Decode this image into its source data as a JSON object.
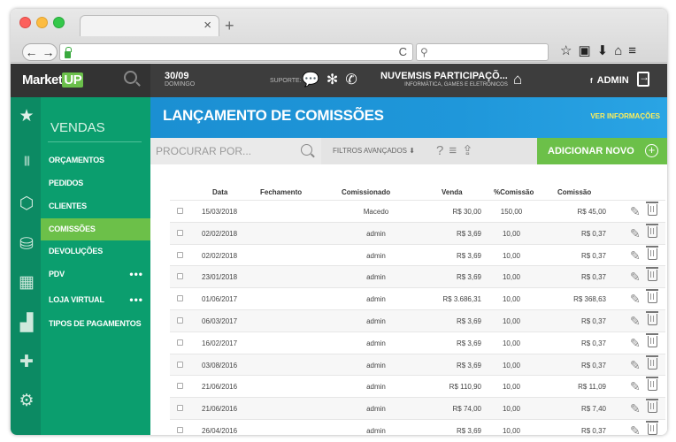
{
  "browser": {
    "tab_close": "×",
    "new_tab": "+",
    "back": "←",
    "forward": "→",
    "reload": "C",
    "search_glass": "⚲",
    "toolbar_icons": "☆▣⬇⌂≡"
  },
  "header": {
    "logo_market": "Market",
    "logo_up": "UP",
    "date": "30/09",
    "weekday": "DOMINGO",
    "support_label": "SUPORTE:",
    "support_icons": "💬✻✆",
    "company": "NUVEMSIS PARTICIPAÇÕ...",
    "company_sub": "INFORMÁTICA, GAMES E ELETRÔNICOS",
    "home_icon": "⌂",
    "user_prefix": "f",
    "user": "ADMIN"
  },
  "iconbar": [
    "★",
    "|||",
    "⬡",
    "⛁",
    "▦",
    "▟",
    "✚",
    "⚙"
  ],
  "sidebar": {
    "title": "VENDAS",
    "items": [
      {
        "label": "ORÇAMENTOS"
      },
      {
        "label": "PEDIDOS"
      },
      {
        "label": "CLIENTES"
      },
      {
        "label": "COMISSÕES",
        "active": true
      },
      {
        "label": "DEVOLUÇÕES"
      },
      {
        "label": "PDV",
        "more": "•••"
      },
      {
        "label": "LOJA VIRTUAL",
        "more": "•••"
      },
      {
        "label": "TIPOS DE PAGAMENTOS"
      }
    ]
  },
  "main": {
    "title": "LANÇAMENTO DE COMISSÕES",
    "more_info": "VER INFORMAÇÕES",
    "search_placeholder": "PROCURAR POR...",
    "filters": "FILTROS AVANÇADOS ⬇",
    "tool_icons": "?≡⇪",
    "add_button": "ADICIONAR NOVO",
    "add_plus": "+"
  },
  "table": {
    "headers": [
      "Data",
      "Fechamento",
      "Comissionado",
      "Venda",
      "%Comissão",
      "Comissão"
    ],
    "rows": [
      {
        "data": "15/03/2018",
        "fechamento": "",
        "comissionado": "Macedo",
        "venda": "R$ 30,00",
        "pct": "150,00",
        "comissao": "R$ 45,00"
      },
      {
        "data": "02/02/2018",
        "fechamento": "",
        "comissionado": "admin",
        "venda": "R$ 3,69",
        "pct": "10,00",
        "comissao": "R$ 0,37"
      },
      {
        "data": "02/02/2018",
        "fechamento": "",
        "comissionado": "admin",
        "venda": "R$ 3,69",
        "pct": "10,00",
        "comissao": "R$ 0,37"
      },
      {
        "data": "23/01/2018",
        "fechamento": "",
        "comissionado": "admin",
        "venda": "R$ 3,69",
        "pct": "10,00",
        "comissao": "R$ 0,37"
      },
      {
        "data": "01/06/2017",
        "fechamento": "",
        "comissionado": "admin",
        "venda": "R$ 3.686,31",
        "pct": "10,00",
        "comissao": "R$ 368,63"
      },
      {
        "data": "06/03/2017",
        "fechamento": "",
        "comissionado": "admin",
        "venda": "R$ 3,69",
        "pct": "10,00",
        "comissao": "R$ 0,37"
      },
      {
        "data": "16/02/2017",
        "fechamento": "",
        "comissionado": "admin",
        "venda": "R$ 3,69",
        "pct": "10,00",
        "comissao": "R$ 0,37"
      },
      {
        "data": "03/08/2016",
        "fechamento": "",
        "comissionado": "admin",
        "venda": "R$ 3,69",
        "pct": "10,00",
        "comissao": "R$ 0,37"
      },
      {
        "data": "21/06/2016",
        "fechamento": "",
        "comissionado": "admin",
        "venda": "R$ 110,90",
        "pct": "10,00",
        "comissao": "R$ 11,09"
      },
      {
        "data": "21/06/2016",
        "fechamento": "",
        "comissionado": "admin",
        "venda": "R$ 74,00",
        "pct": "10,00",
        "comissao": "R$ 7,40"
      },
      {
        "data": "26/04/2016",
        "fechamento": "",
        "comissionado": "admin",
        "venda": "R$ 3,69",
        "pct": "10,00",
        "comissao": "R$ 0,37"
      }
    ],
    "edit_icon": "✎"
  }
}
